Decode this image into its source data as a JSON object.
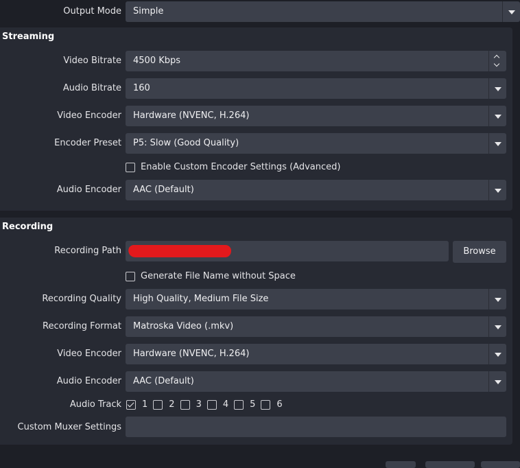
{
  "output_mode": {
    "label": "Output Mode",
    "value": "Simple"
  },
  "streaming": {
    "title": "Streaming",
    "video_bitrate": {
      "label": "Video Bitrate",
      "value": "4500 Kbps"
    },
    "audio_bitrate": {
      "label": "Audio Bitrate",
      "value": "160"
    },
    "video_encoder": {
      "label": "Video Encoder",
      "value": "Hardware (NVENC, H.264)"
    },
    "encoder_preset": {
      "label": "Encoder Preset",
      "value": "P5: Slow (Good Quality)"
    },
    "custom_encoder": {
      "label": "Enable Custom Encoder Settings (Advanced)",
      "checked": false
    },
    "audio_encoder": {
      "label": "Audio Encoder",
      "value": "AAC (Default)"
    }
  },
  "recording": {
    "title": "Recording",
    "path": {
      "label": "Recording Path",
      "value": ""
    },
    "browse_label": "Browse",
    "no_space": {
      "label": "Generate File Name without Space",
      "checked": false
    },
    "quality": {
      "label": "Recording Quality",
      "value": "High Quality, Medium File Size"
    },
    "format": {
      "label": "Recording Format",
      "value": "Matroska Video (.mkv)"
    },
    "video_encoder": {
      "label": "Video Encoder",
      "value": "Hardware (NVENC, H.264)"
    },
    "audio_encoder": {
      "label": "Audio Encoder",
      "value": "AAC (Default)"
    },
    "audio_track": {
      "label": "Audio Track",
      "tracks": [
        {
          "label": "1",
          "checked": true
        },
        {
          "label": "2",
          "checked": false
        },
        {
          "label": "3",
          "checked": false
        },
        {
          "label": "4",
          "checked": false
        },
        {
          "label": "5",
          "checked": false
        },
        {
          "label": "6",
          "checked": false
        }
      ]
    },
    "muxer": {
      "label": "Custom Muxer Settings",
      "value": ""
    }
  },
  "icons": {
    "combo_arrow": "chevron-down-icon",
    "spin_up": "chevron-up-icon",
    "spin_down": "chevron-down-icon",
    "check": "checkmark-icon"
  },
  "colors": {
    "background": "#1d1f26",
    "panel": "#272a33",
    "field": "#3c404b",
    "text": "#e4e4e7",
    "redaction": "#e3191c"
  }
}
